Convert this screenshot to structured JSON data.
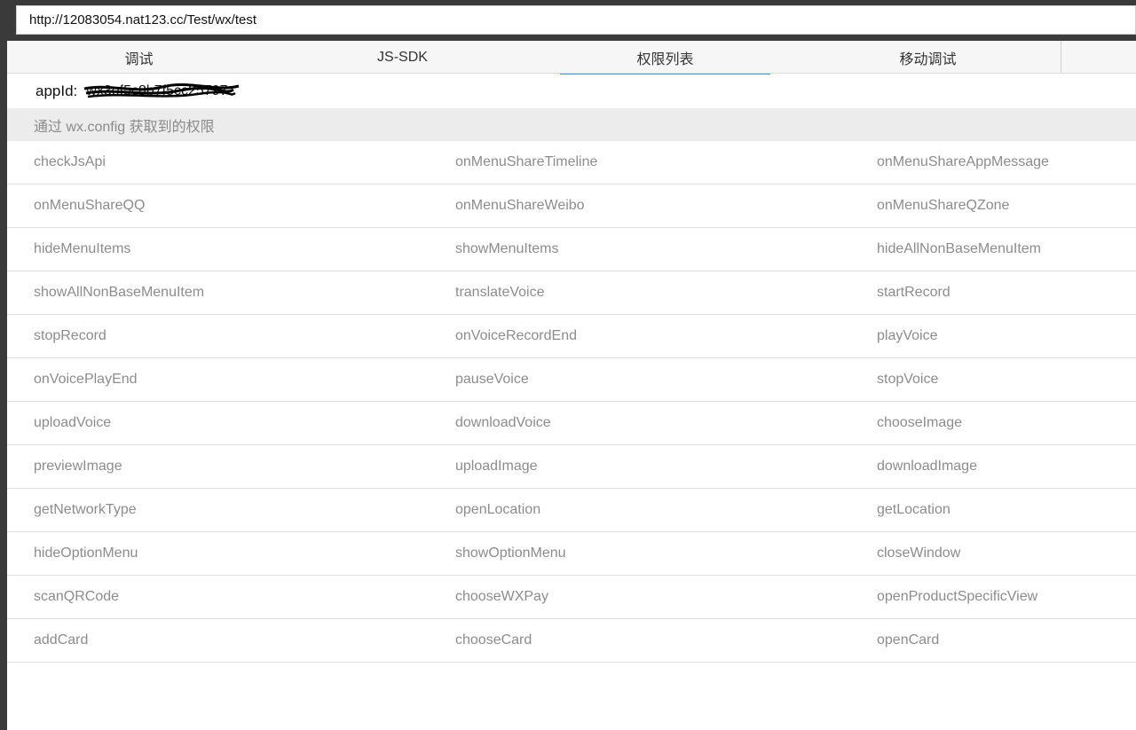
{
  "browser": {
    "url": "http://12083054.nat123.cc/Test/wx/test"
  },
  "tabs": [
    {
      "label": "调试",
      "active": false
    },
    {
      "label": "JS-SDK",
      "active": false
    },
    {
      "label": "权限列表",
      "active": true
    },
    {
      "label": "移动调试",
      "active": false
    }
  ],
  "appid": {
    "label": "appId:",
    "value": "wx3ef5c8b7f5cc25797"
  },
  "section": {
    "title": "通过 wx.config 获取到的权限"
  },
  "permissions": [
    [
      "checkJsApi",
      "onMenuShareTimeline",
      "onMenuShareAppMessage"
    ],
    [
      "onMenuShareQQ",
      "onMenuShareWeibo",
      "onMenuShareQZone"
    ],
    [
      "hideMenuItems",
      "showMenuItems",
      "hideAllNonBaseMenuItem"
    ],
    [
      "showAllNonBaseMenuItem",
      "translateVoice",
      "startRecord"
    ],
    [
      "stopRecord",
      "onVoiceRecordEnd",
      "playVoice"
    ],
    [
      "onVoicePlayEnd",
      "pauseVoice",
      "stopVoice"
    ],
    [
      "uploadVoice",
      "downloadVoice",
      "chooseImage"
    ],
    [
      "previewImage",
      "uploadImage",
      "downloadImage"
    ],
    [
      "getNetworkType",
      "openLocation",
      "getLocation"
    ],
    [
      "hideOptionMenu",
      "showOptionMenu",
      "closeWindow"
    ],
    [
      "scanQRCode",
      "chooseWXPay",
      "openProductSpecificView"
    ],
    [
      "addCard",
      "chooseCard",
      "openCard"
    ]
  ],
  "colors": {
    "accent": "#3c9bc4",
    "section_bg": "#ececec",
    "item_text": "#8c8c8c"
  }
}
